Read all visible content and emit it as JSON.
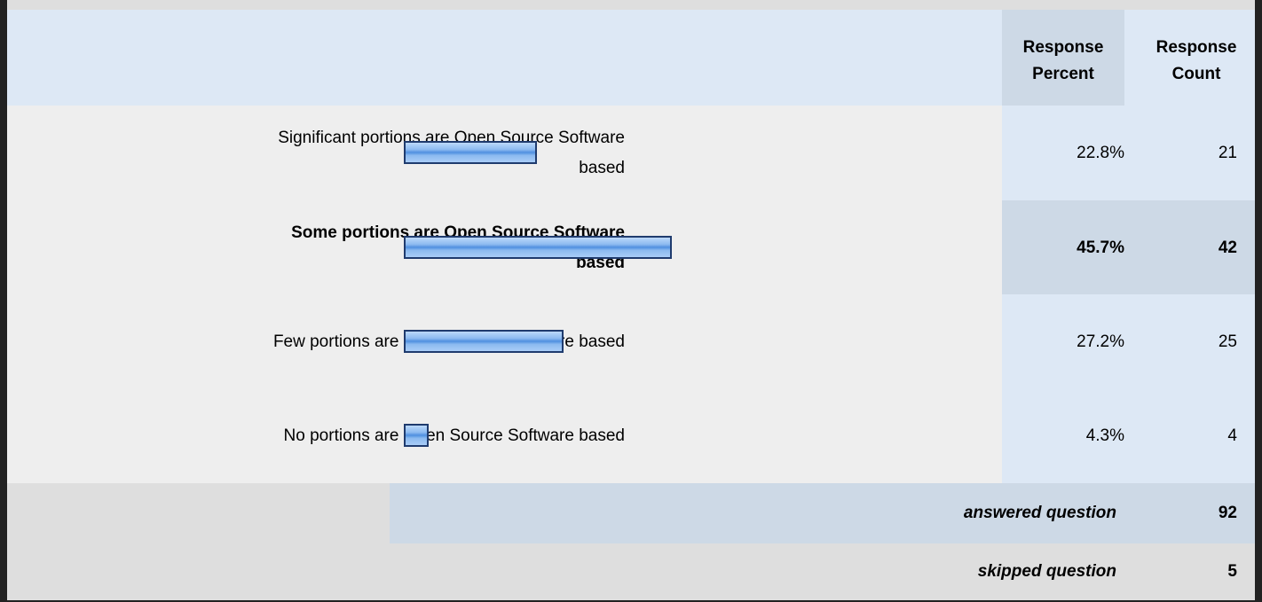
{
  "header": {
    "percent_label": "Response Percent",
    "count_label": "Response Count"
  },
  "chart_data": {
    "type": "bar",
    "orientation": "horizontal",
    "categories": [
      "Significant portions are Open Source Software based",
      "Some portions are Open Source Software based",
      "Few portions are Open Source Software based",
      "No portions are Open Source Software based"
    ],
    "values": [
      22.8,
      45.7,
      27.2,
      4.3
    ],
    "percent_labels": [
      "22.8%",
      "45.7%",
      "27.2%",
      "4.3%"
    ],
    "counts": [
      "21",
      "42",
      "25",
      "4"
    ],
    "highlight_index": 1,
    "xlim": [
      0,
      100
    ]
  },
  "summary": {
    "answered_label": "answered question",
    "answered_value": "92",
    "skipped_label": "skipped question",
    "skipped_value": "5"
  },
  "colors": {
    "bar_fill": "#8cbaf0",
    "bar_border": "#1f3b6e",
    "header_bg": "#dde8f5",
    "highlight_bg": "#cdd9e6"
  }
}
